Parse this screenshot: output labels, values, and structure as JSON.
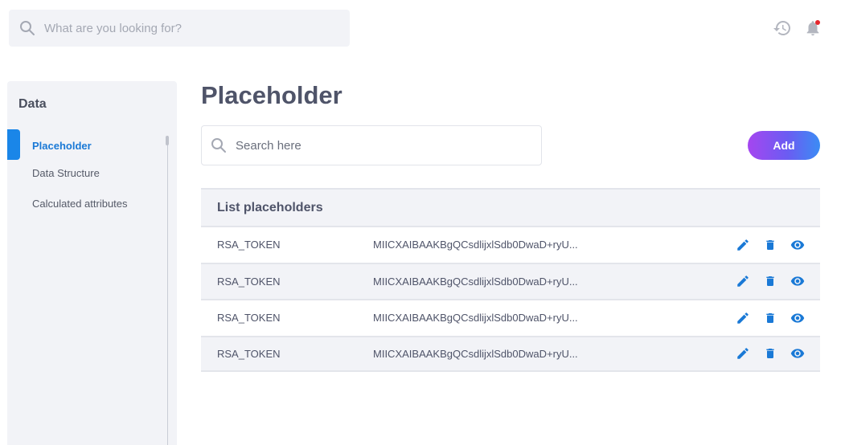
{
  "header": {
    "search": {
      "placeholder": "What are you looking for?",
      "value": ""
    },
    "icons": [
      "history-icon",
      "notification-bell-icon"
    ]
  },
  "sidebar": {
    "title": "Data",
    "items": [
      {
        "label": "Placeholder",
        "active": true
      },
      {
        "label": "Data Structure",
        "active": false
      },
      {
        "label": "Calculated attributes",
        "active": false
      }
    ]
  },
  "main": {
    "title": "Placeholder",
    "search": {
      "placeholder": "Search here",
      "value": ""
    },
    "add_label": "Add",
    "list": {
      "title": "List placeholders",
      "rows": [
        {
          "name": "RSA_TOKEN",
          "value": "MIICXAIBAAKBgQCsdlijxlSdb0DwaD+ryU..."
        },
        {
          "name": "RSA_TOKEN",
          "value": "MIICXAIBAAKBgQCsdlijxlSdb0DwaD+ryU..."
        },
        {
          "name": "RSA_TOKEN",
          "value": "MIICXAIBAAKBgQCsdlijxlSdb0DwaD+ryU..."
        },
        {
          "name": "RSA_TOKEN",
          "value": "MIICXAIBAAKBgQCsdlijxlSdb0DwaD+ryU..."
        }
      ]
    }
  },
  "colors": {
    "accent": "#1a86e8",
    "add_gradient": [
      "#a546f0",
      "#3b8cf4"
    ],
    "notification_dot": "#e5262d"
  }
}
